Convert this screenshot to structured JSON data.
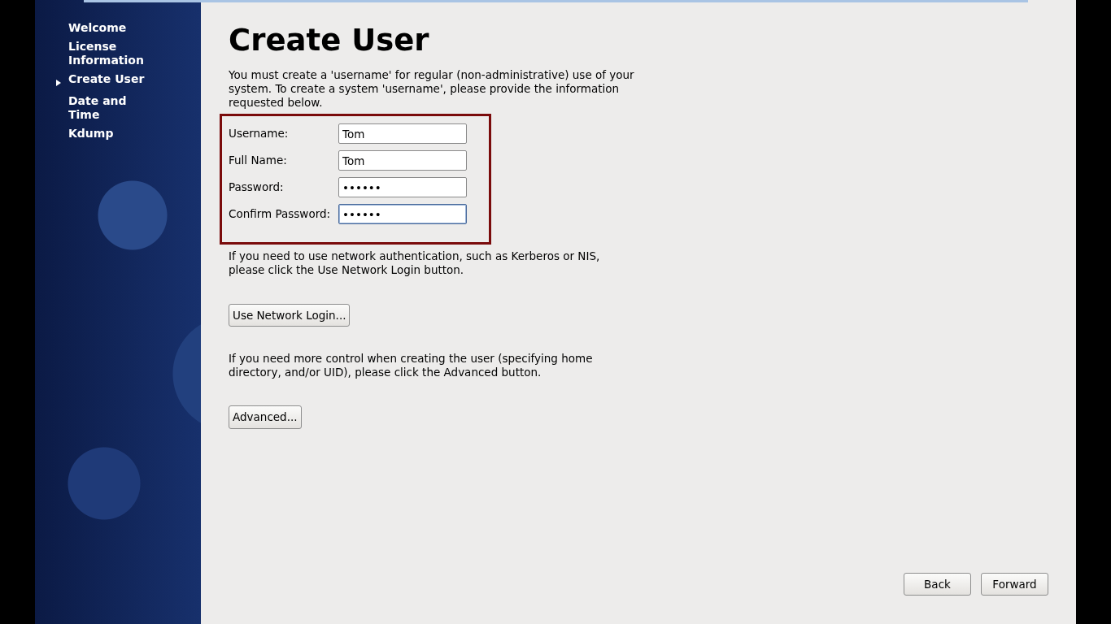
{
  "sidebar": {
    "items": [
      {
        "label": "Welcome",
        "selected": false
      },
      {
        "label": "License Information",
        "selected": false
      },
      {
        "label": "Create User",
        "selected": true
      },
      {
        "label": "Date and Time",
        "selected": false
      },
      {
        "label": "Kdump",
        "selected": false
      }
    ]
  },
  "title": "Create User",
  "intro": "You must create a 'username' for regular (non-administrative) use of your system.  To create a system 'username', please provide the information requested below.",
  "fields": [
    {
      "label": "Username:",
      "value": "Tom",
      "focused": false
    },
    {
      "label": "Full Name:",
      "value": "Tom",
      "focused": false
    },
    {
      "label": "Password:",
      "value": "••••••",
      "focused": false
    },
    {
      "label": "Confirm Password:",
      "value": "••••••",
      "focused": true
    }
  ],
  "network_text": "If you need to use network authentication, such as Kerberos or NIS, please click the Use Network Login button.",
  "network_button": "Use Network Login...",
  "advanced_text": "If you need more control when creating the user (specifying home directory, and/or UID), please click the Advanced button.",
  "advanced_button": "Advanced...",
  "nav_buttons": [
    "Back",
    "Forward"
  ]
}
